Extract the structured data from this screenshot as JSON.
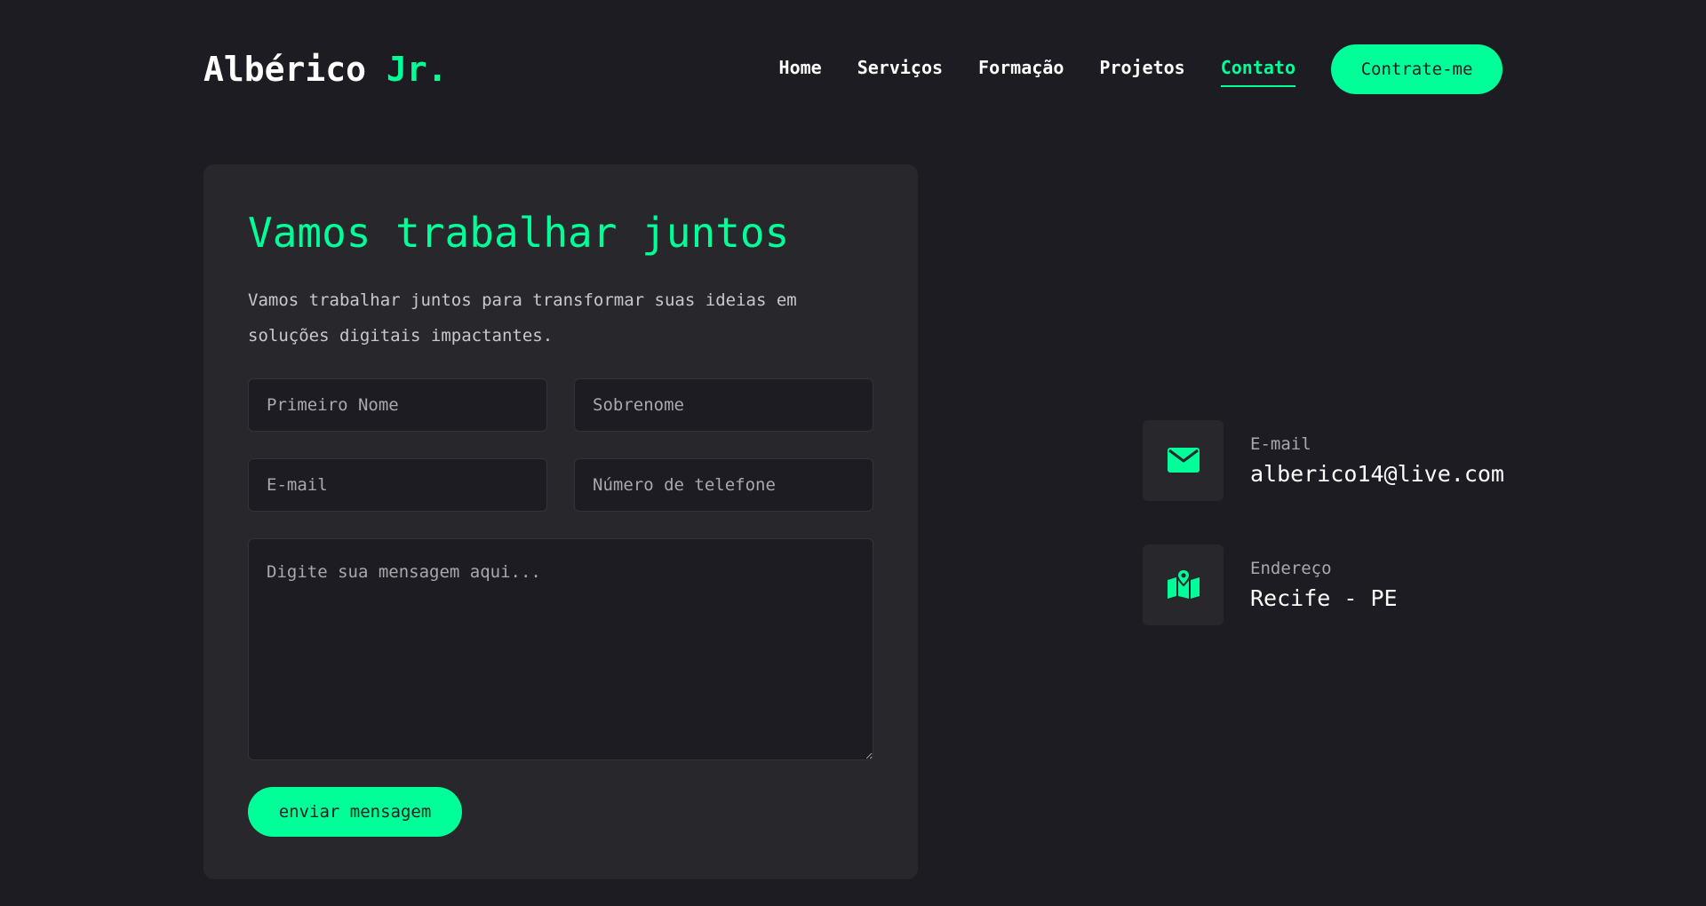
{
  "header": {
    "logo_main": "Albérico",
    "logo_accent": "Jr.",
    "nav": [
      {
        "label": "Home"
      },
      {
        "label": "Serviços"
      },
      {
        "label": "Formação"
      },
      {
        "label": "Projetos"
      },
      {
        "label": "Contato",
        "active": true
      }
    ],
    "cta_label": "Contrate-me"
  },
  "form": {
    "title": "Vamos trabalhar juntos",
    "description": "Vamos trabalhar juntos para transformar suas ideias em soluções digitais impactantes.",
    "first_name_placeholder": "Primeiro Nome",
    "last_name_placeholder": "Sobrenome",
    "email_placeholder": "E-mail",
    "phone_placeholder": "Número de telefone",
    "message_placeholder": "Digite sua mensagem aqui...",
    "submit_label": "enviar mensagem"
  },
  "info": [
    {
      "label": "E-mail",
      "value": "alberico14@live.com",
      "icon": "envelope-icon"
    },
    {
      "label": "Endereço",
      "value": "Recife - PE",
      "icon": "map-pin-icon"
    }
  ],
  "colors": {
    "background": "#1c1c22",
    "card": "#27272c",
    "accent": "#00ff99",
    "text": "#ffffff",
    "muted": "#a8a8ad"
  }
}
